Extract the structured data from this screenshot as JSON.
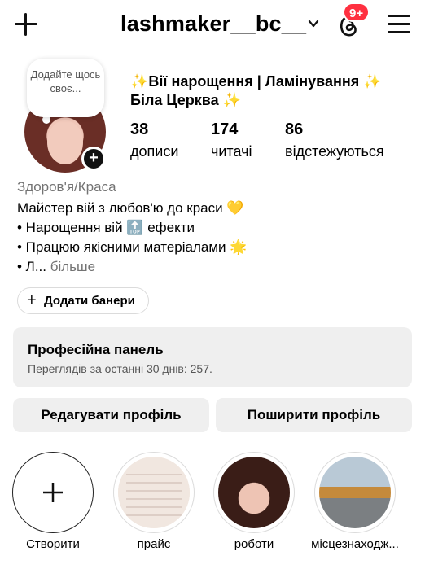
{
  "header": {
    "username": "lashmaker__bc__",
    "notifications_badge": "9+"
  },
  "note": {
    "text": "Додайте щось своє..."
  },
  "profile": {
    "full_name_line1": "✨Вії нарощення | Ламінування ✨",
    "full_name_line2": "Біла Церква ✨",
    "stats": [
      {
        "value": "38",
        "label": "дописи"
      },
      {
        "value": "174",
        "label": "читачі"
      },
      {
        "value": "86",
        "label": "відстежуються"
      }
    ],
    "category": "Здоров'я/Краса",
    "bio": [
      "Майстер вій з любов'ю до краси 💛",
      "• Нарощення вій 🔝 ефекти",
      "• Працюю якісними матеріалами 🌟"
    ],
    "bio_truncated": "• Л...",
    "more_label": "більше"
  },
  "banners_button": {
    "label": "Додати банери"
  },
  "pro_panel": {
    "title": "Професійна панель",
    "subtitle": "Переглядів за останні 30 днів: 257."
  },
  "actions": {
    "edit_label": "Редагувати профіль",
    "share_label": "Поширити профіль"
  },
  "highlights": [
    {
      "label": "Створити",
      "icon": "plus-icon"
    },
    {
      "label": "прайс"
    },
    {
      "label": "роботи"
    },
    {
      "label": "місцезнаходж..."
    }
  ],
  "colors": {
    "badge": "#ff3040",
    "panel_bg": "#efefef",
    "muted_text": "#737373"
  }
}
